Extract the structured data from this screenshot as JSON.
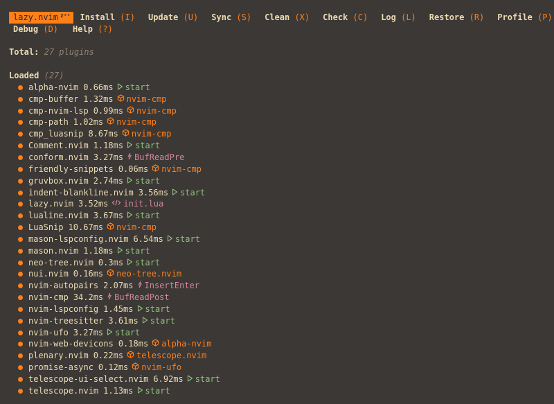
{
  "menu": {
    "brand": "lazy.nvim",
    "brand_badge": "zᶻᶻ",
    "items_row1": [
      {
        "label": "Install",
        "key": "(I)"
      },
      {
        "label": "Update",
        "key": "(U)"
      },
      {
        "label": "Sync",
        "key": "(S)"
      },
      {
        "label": "Clean",
        "key": "(X)"
      },
      {
        "label": "Check",
        "key": "(C)"
      },
      {
        "label": "Log",
        "key": "(L)"
      },
      {
        "label": "Restore",
        "key": "(R)"
      },
      {
        "label": "Profile",
        "key": "(P)"
      }
    ],
    "items_row2": [
      {
        "label": "Debug",
        "key": "(D)"
      },
      {
        "label": "Help",
        "key": "(?)"
      }
    ]
  },
  "summary": {
    "total_label": "Total:",
    "total_value": "27 plugins",
    "loaded_label": "Loaded",
    "loaded_count": "(27)"
  },
  "colors": {
    "background": "#3c3836",
    "accent": "#fe8019",
    "start": "#8ec07c",
    "event": "#d3869b"
  },
  "plugins": [
    {
      "name": "alpha-nvim",
      "time": "0.66ms",
      "source": "start",
      "type": "start"
    },
    {
      "name": "cmp-buffer",
      "time": "1.32ms",
      "source": "nvim-cmp",
      "type": "plugin"
    },
    {
      "name": "cmp-nvim-lsp",
      "time": "0.99ms",
      "source": "nvim-cmp",
      "type": "plugin"
    },
    {
      "name": "cmp-path",
      "time": "1.02ms",
      "source": "nvim-cmp",
      "type": "plugin"
    },
    {
      "name": "cmp_luasnip",
      "time": "8.67ms",
      "source": "nvim-cmp",
      "type": "plugin"
    },
    {
      "name": "Comment.nvim",
      "time": "1.18ms",
      "source": "start",
      "type": "start"
    },
    {
      "name": "conform.nvim",
      "time": "3.27ms",
      "source": "BufReadPre",
      "type": "event"
    },
    {
      "name": "friendly-snippets",
      "time": "0.06ms",
      "source": "nvim-cmp",
      "type": "plugin"
    },
    {
      "name": "gruvbox.nvim",
      "time": "2.74ms",
      "source": "start",
      "type": "start"
    },
    {
      "name": "indent-blankline.nvim",
      "time": "3.56ms",
      "source": "start",
      "type": "start"
    },
    {
      "name": "lazy.nvim",
      "time": "3.52ms",
      "source": "init.lua",
      "type": "cmd"
    },
    {
      "name": "lualine.nvim",
      "time": "3.67ms",
      "source": "start",
      "type": "start"
    },
    {
      "name": "LuaSnip",
      "time": "10.67ms",
      "source": "nvim-cmp",
      "type": "plugin"
    },
    {
      "name": "mason-lspconfig.nvim",
      "time": "6.54ms",
      "source": "start",
      "type": "start"
    },
    {
      "name": "mason.nvim",
      "time": "1.18ms",
      "source": "start",
      "type": "start"
    },
    {
      "name": "neo-tree.nvim",
      "time": "0.3ms",
      "source": "start",
      "type": "start"
    },
    {
      "name": "nui.nvim",
      "time": "0.16ms",
      "source": "neo-tree.nvim",
      "type": "plugin"
    },
    {
      "name": "nvim-autopairs",
      "time": "2.07ms",
      "source": "InsertEnter",
      "type": "event"
    },
    {
      "name": "nvim-cmp",
      "time": "34.2ms",
      "source": "BufReadPost",
      "type": "event"
    },
    {
      "name": "nvim-lspconfig",
      "time": "1.45ms",
      "source": "start",
      "type": "start"
    },
    {
      "name": "nvim-treesitter",
      "time": "3.61ms",
      "source": "start",
      "type": "start"
    },
    {
      "name": "nvim-ufo",
      "time": "3.27ms",
      "source": "start",
      "type": "start"
    },
    {
      "name": "nvim-web-devicons",
      "time": "0.18ms",
      "source": "alpha-nvim",
      "type": "plugin"
    },
    {
      "name": "plenary.nvim",
      "time": "0.22ms",
      "source": "telescope.nvim",
      "type": "plugin"
    },
    {
      "name": "promise-async",
      "time": "0.12ms",
      "source": "nvim-ufo",
      "type": "plugin"
    },
    {
      "name": "telescope-ui-select.nvim",
      "time": "6.92ms",
      "source": "start",
      "type": "start"
    },
    {
      "name": "telescope.nvim",
      "time": "1.13ms",
      "source": "start",
      "type": "start"
    }
  ]
}
